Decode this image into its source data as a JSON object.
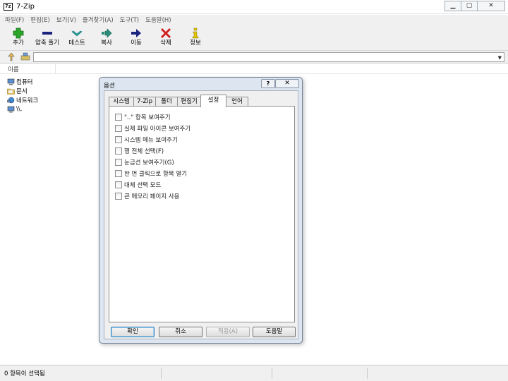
{
  "window": {
    "title": "7-Zip",
    "app_icon_text": "7z"
  },
  "menu": [
    "파일(F)",
    "편집(E)",
    "보기(V)",
    "즐겨찾기(A)",
    "도구(T)",
    "도움말(H)"
  ],
  "toolbar": {
    "add": "추가",
    "extract": "압축 풀기",
    "test": "테스트",
    "copy": "복사",
    "move": "이동",
    "delete": "삭제",
    "info": "정보"
  },
  "list": {
    "column_name": "이름",
    "items": [
      "컴퓨터",
      "문서",
      "네트워크",
      "\\\\."
    ]
  },
  "status": {
    "text": "0 항목이 선택됨"
  },
  "dialog": {
    "title": "옵션",
    "help": "?",
    "close": "✕",
    "tabs": [
      "시스템",
      "7-Zip",
      "폴더",
      "편집기",
      "설정",
      "언어"
    ],
    "active_tab": "설정",
    "options": [
      {
        "label": "\"..\" 항목 보여주기",
        "checked": false
      },
      {
        "label": "실제 파일 아이콘 보여주기",
        "checked": false
      },
      {
        "label": "시스템 메뉴 보여주기",
        "checked": false
      },
      {
        "label": "행 전체 선택(F)",
        "checked": false
      },
      {
        "label": "눈금선 보여주기(G)",
        "checked": false
      },
      {
        "label": "한 번 클릭으로 항목 열기",
        "checked": false
      },
      {
        "label": "대체 선택 모드",
        "checked": false
      },
      {
        "label": "큰 메모리 페이지 사용",
        "checked": false
      }
    ],
    "buttons": {
      "ok": "확인",
      "cancel": "취소",
      "apply": "적용(A)",
      "help": "도움말"
    }
  },
  "colors": {
    "add": "#2aa62a",
    "extract": "#1a237e",
    "test": "#2aa6a6",
    "copy": "#2a8f7a",
    "move": "#1a237e",
    "delete": "#d01c1c",
    "info": "#e0c400"
  }
}
